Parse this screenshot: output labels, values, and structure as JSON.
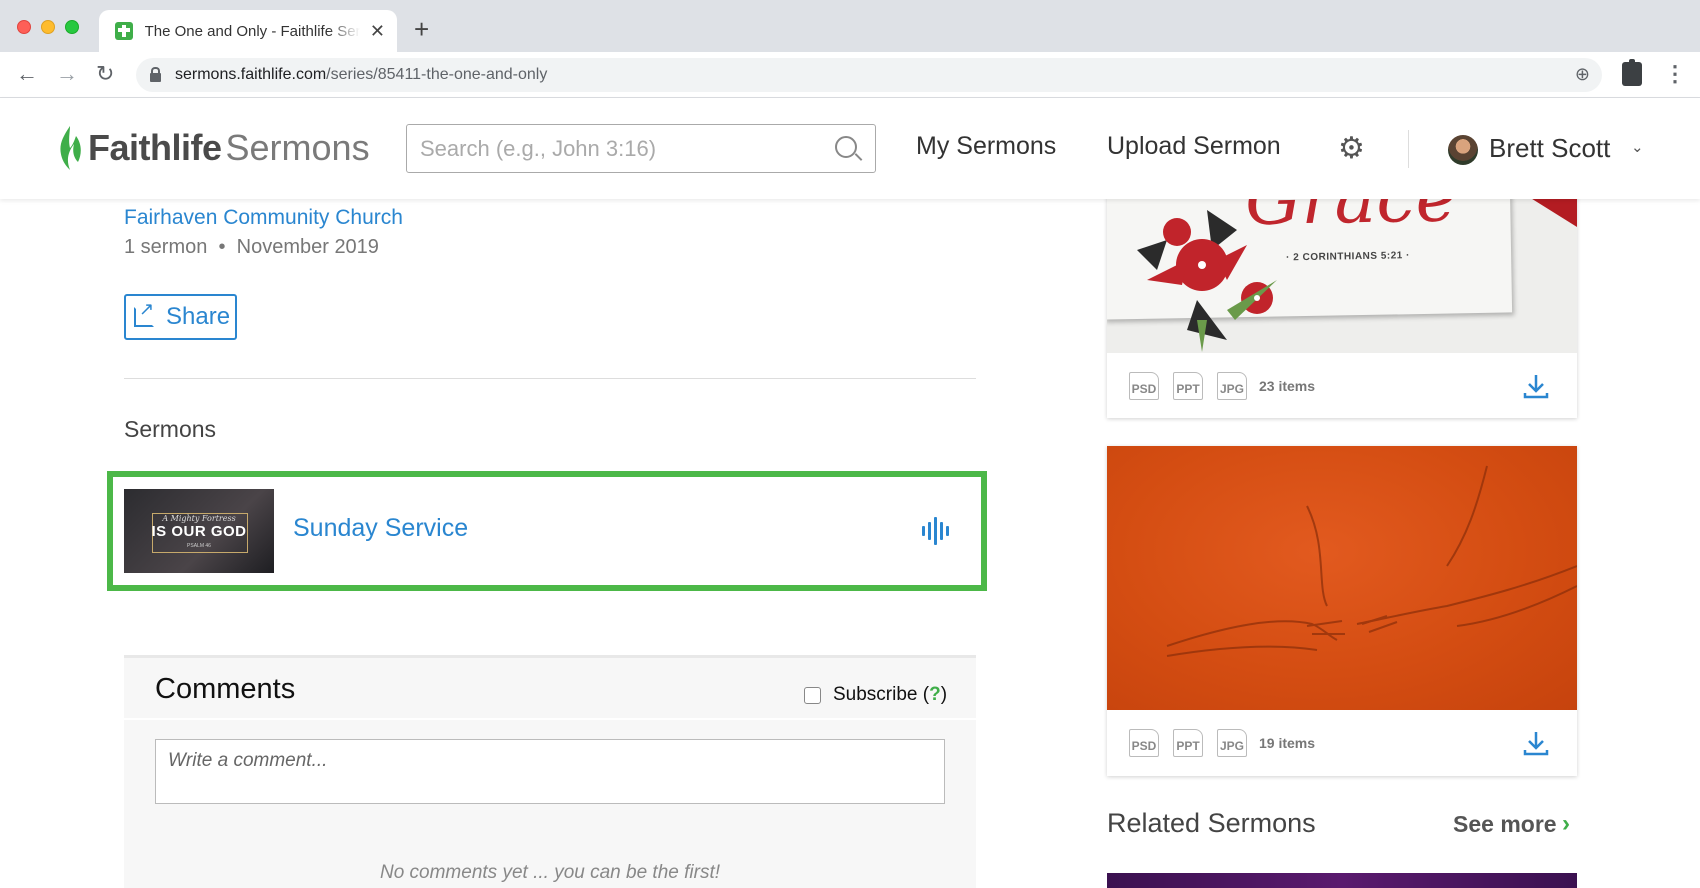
{
  "browser": {
    "tab_title": "The One and Only - Faithlife Sermons",
    "url_host": "sermons.faithlife.com",
    "url_path": "/series/85411-the-one-and-only"
  },
  "header": {
    "logo_bold": "Faithlife",
    "logo_light": "Sermons",
    "search_placeholder": "Search (e.g., John 3:16)",
    "nav_my_sermons": "My Sermons",
    "nav_upload": "Upload Sermon",
    "user_name": "Brett Scott",
    "brand_green": "#3fae49"
  },
  "series": {
    "church": "Fairhaven Community Church",
    "sermon_count": "1 sermon",
    "date": "November 2019",
    "share_label": "Share"
  },
  "sermons": {
    "heading": "Sermons",
    "items": [
      {
        "title": "Sunday Service",
        "thumb_small": "A Mighty Fortress",
        "thumb_big": "IS OUR GOD",
        "thumb_tiny": "PSALM 46"
      }
    ],
    "highlight_color": "#4cb848"
  },
  "comments": {
    "title": "Comments",
    "subscribe_label": "Subscribe",
    "help": "?",
    "placeholder": "Write a comment...",
    "empty_text": "No comments yet ... you can be the first!"
  },
  "resources": [
    {
      "image_word": "Grace",
      "image_ref": "· 2 CORINTHIANS 5:21 ·",
      "formats": [
        "PSD",
        "PPT",
        "JPG"
      ],
      "count": "23 items"
    },
    {
      "formats": [
        "PSD",
        "PPT",
        "JPG"
      ],
      "count": "19 items"
    }
  ],
  "related": {
    "heading": "Related Sermons",
    "see_more": "See more"
  }
}
